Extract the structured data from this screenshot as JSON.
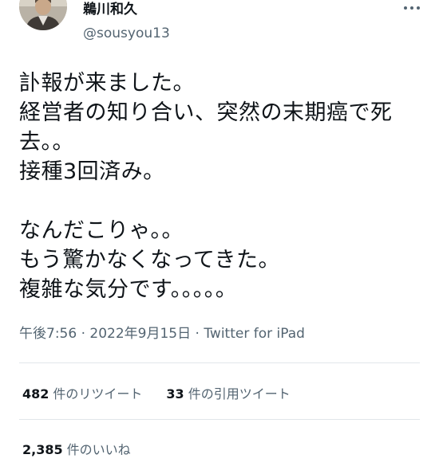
{
  "author": {
    "name": "鵜川和久",
    "handle": "@sousyou13"
  },
  "body_lines": [
    "訃報が来ました。",
    "経営者の知り合い、突然の末期癌で死",
    "去。。",
    "接種3回済み。",
    "",
    "なんだこりゃ。。",
    "もう驚かなくなってきた。",
    "複雑な気分です。。。。。"
  ],
  "meta": {
    "time": "午後7:56",
    "sep1": " · ",
    "date": "2022年9月15日",
    "sep2": " · ",
    "source": "Twitter for iPad"
  },
  "stats": {
    "retweets": {
      "count": "482",
      "label": "件のリツイート"
    },
    "quotes": {
      "count": "33",
      "label": "件の引用ツイート"
    },
    "likes": {
      "count": "2,385",
      "label": "件のいいね"
    }
  },
  "icons": {
    "avatar": "profile-photo",
    "more": "more-horizontal-icon"
  },
  "colors": {
    "text_primary": "#0f1419",
    "text_secondary": "#536471",
    "divider": "#e1e6ea"
  }
}
